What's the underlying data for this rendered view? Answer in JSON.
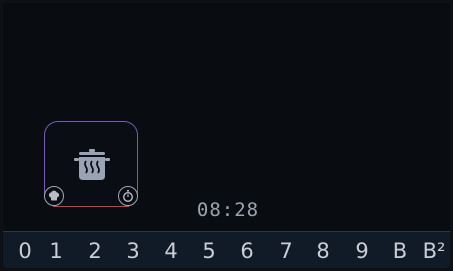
{
  "zone": {
    "pot_icon": "pot-steam-icon",
    "left_icon": "chef-hat-icon",
    "right_icon": "stopwatch-icon"
  },
  "clock": {
    "time": "08:28"
  },
  "power_levels": [
    "0",
    "1",
    "2",
    "3",
    "4",
    "5",
    "6",
    "7",
    "8",
    "9",
    "B",
    "B²"
  ],
  "colors": {
    "background": "#090c11",
    "tile_border": "#7a5ab8",
    "tile_border_active": "#e4333d",
    "bar": "#111a27",
    "text": "#c9ced6"
  }
}
